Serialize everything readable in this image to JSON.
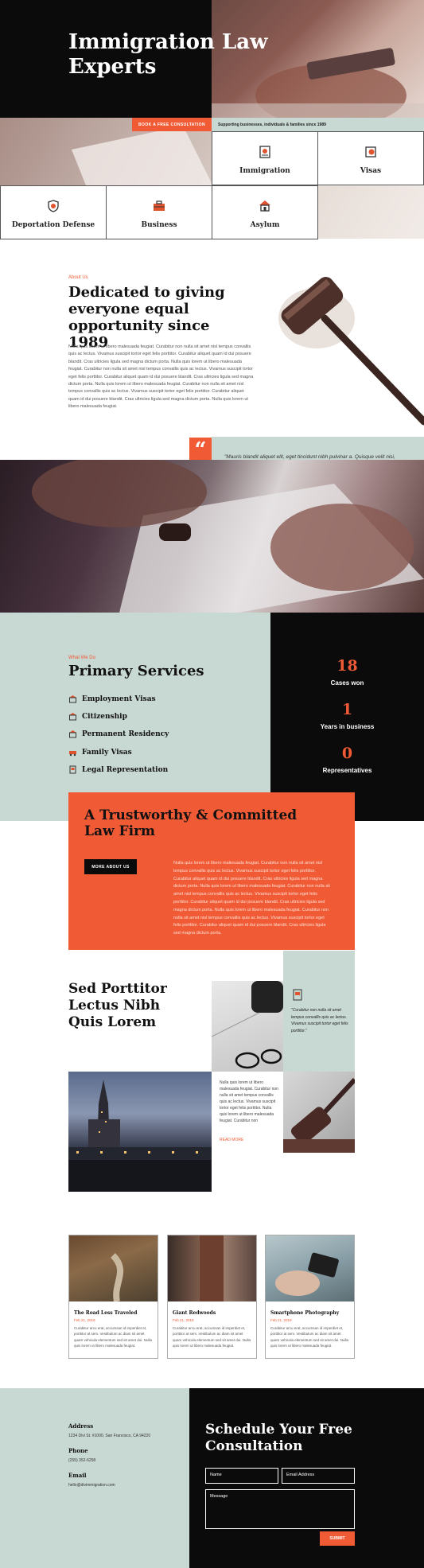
{
  "hero": {
    "title": "Immigration Law Experts",
    "consult_button": "BOOK A FREE CONSULTATION",
    "tagline": "Supporting businesses, individuals & families since 1989"
  },
  "practice_areas": [
    {
      "label": "Immigration",
      "icon": "passport-icon"
    },
    {
      "label": "Visas",
      "icon": "visa-stamp-icon"
    },
    {
      "label": "Deportation Defense",
      "icon": "shield-icon"
    },
    {
      "label": "Business",
      "icon": "briefcase-icon"
    },
    {
      "label": "Asylum",
      "icon": "house-icon"
    }
  ],
  "about": {
    "label": "About Us",
    "title": "Dedicated to giving everyone equal opportunity since 1989",
    "body": "Nulla quis lorem ut libero malesuada feugiat. Curabitur non nulla sit amet nisl tempus convallis quis ac lectus. Vivamus suscipit tortor eget felis porttitor. Curabitur aliquet quam id dui posuere blandit. Cras ultricies ligula sed magna dictum porta. Nulla quis lorem ut libero malesuada feugiat. Curabitur non nulla sit amet nisl tempus convallis quis ac lectus. Vivamus suscipit tortor eget felis porttitor. Curabitur aliquet quam id dui posuere blandit. Cras ultricies ligula sed magna dictum porta. Nulla quis lorem ut libero malesuada feugiat. Curabitur non nulla sit amet nisl tempus convallis quis ac lectus. Vivamus suscipit tortor eget felis porttitor. Curabitur aliquet quam id dui posuere blandit. Cras ultricies ligula sed magna dictum porta. Nulla quis lorem ut libero malesuada feugiat.",
    "quote_mark": "“",
    "quote": "\"Mauris blandit aliquet elit, eget tincidunt nibh pulvinar a. Quisque velit nisi, pretium ut lacinia in, elementum id enim. Donec sollicitudin molestie malesuada.\""
  },
  "services": {
    "label": "What We Do",
    "title": "Primary Services",
    "items": [
      {
        "label": "Employment Visas",
        "icon": "building-icon"
      },
      {
        "label": "Citizenship",
        "icon": "building-icon"
      },
      {
        "label": "Permanent Residency",
        "icon": "building-icon"
      },
      {
        "label": "Family Visas",
        "icon": "car-icon"
      },
      {
        "label": "Legal Representation",
        "icon": "document-icon"
      }
    ]
  },
  "stats": [
    {
      "value": "18",
      "label": "Cases won"
    },
    {
      "value": "1",
      "label": "Years in business"
    },
    {
      "value": "0",
      "label": "Representatives"
    }
  ],
  "trust": {
    "title": "A Trustworthy & Committed Law Firm",
    "button": "MORE ABOUT US",
    "body": "Nulla quis lorem ut libero malesuada feugiat. Curabitur non nulla sit amet nisl tempus convallis quis ac lectus. Vivamus suscipit tortor eget felis porttitor. Curabitur aliquet quam id dui posuere blandit. Cras ultricies ligula sed magna dictum porta. Nulla quis lorem ut libero malesuada feugiat. Curabitur non nulla sit amet nisl tempus convallis quis ac lectus. Vivamus suscipit tortor eget felis porttitor. Curabitur aliquet quam id dui posuere blandit. Cras ultricies ligula sed magna dictum porta. Nulla quis lorem ut libero malesuada feugiat. Curabitur non nulla sit amet nisl tempus convallis quis ac lectus. Vivamus suscipit tortor eget felis porttitor. Curabitur aliquet quam id dui posuere blandit. Cras ultricies ligula sed magna dictum porta."
  },
  "feature": {
    "title": "Sed Porttitor Lectus Nibh Quis Lorem",
    "quote": "\"Curabitur non nulla sit amet tempus convallis quis ac lectus. Vivamus suscipit tortor eget felis porttitor.\"",
    "body": "Nulla quis lorem ut libero malesuada feugiat. Curabitur non nulla sit amet tempus convallis quis ac lectus. Vivamus suscipit tortor eget felis porttitor. Nulla quis lorem ut libero malesuada feugiat. Curabitur non",
    "read_more": "READ MORE"
  },
  "blog": [
    {
      "title": "The Road Less Traveled",
      "meta": "Feb 21, 2019",
      "excerpt": "Curabitur arcu erat, accumsan id imperdiet et, porttitor at sem. Vestibulum ac diam sit amet quam vehicula elementum sed sit amet dui. Nulla quis lorem ut libero malesuada feugiat."
    },
    {
      "title": "Giant Redwoods",
      "meta": "Feb 21, 2019",
      "excerpt": "Curabitur arcu erat, accumsan id imperdiet et, porttitor at sem. Vestibulum ac diam sit amet quam vehicula elementum sed sit amet dui. Nulla quis lorem ut libero malesuada feugiat."
    },
    {
      "title": "Smartphone Photography",
      "meta": "Feb 21, 2019",
      "excerpt": "Curabitur arcu erat, accumsan id imperdiet et, porttitor at sem. Vestibulum ac diam sit amet quam vehicula elementum sed sit amet dui. Nulla quis lorem ut libero malesuada feugiat."
    }
  ],
  "contact": {
    "address_label": "Address",
    "address": "1234 Divi St. #1000, San Francisco, CA 94220",
    "phone_label": "Phone",
    "phone": "(255) 352-6258",
    "email_label": "Email",
    "email": "hello@divimmigration.com"
  },
  "schedule": {
    "title": "Schedule Your Free Consultation",
    "name_placeholder": "Name",
    "email_placeholder": "Email Address",
    "message_placeholder": "Message",
    "submit": "SUBMIT"
  },
  "colors": {
    "accent": "#f05a35",
    "sage": "#c8d8d2",
    "black": "#0b0b0b"
  }
}
